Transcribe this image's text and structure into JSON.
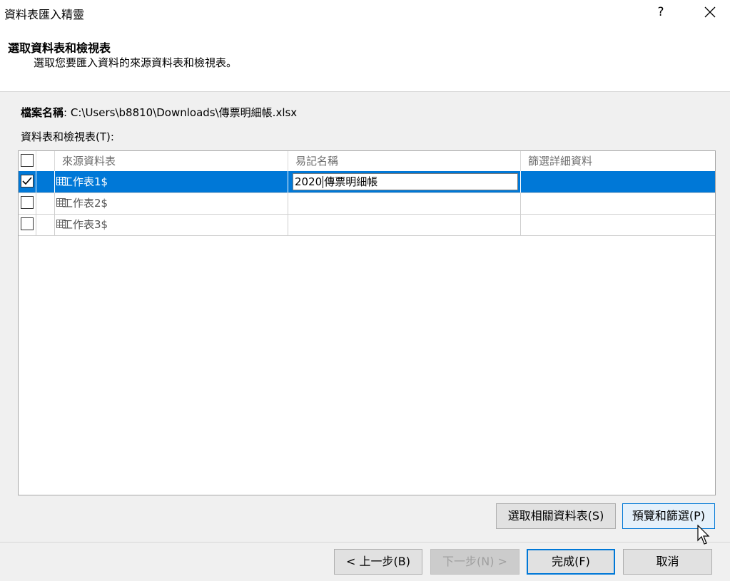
{
  "window": {
    "title": "資料表匯入精靈",
    "help": "?"
  },
  "header": {
    "title": "選取資料表和檢視表",
    "subtitle": "選取您要匯入資料的來源資料表和檢視表。"
  },
  "file": {
    "label": "檔案名稱",
    "separator": ":",
    "path": "C:\\Users\\b8810\\Downloads\\傳票明細帳.xlsx"
  },
  "tables_label": "資料表和檢視表(T):",
  "grid": {
    "columns": [
      "來源資料表",
      "易記名稱",
      "篩選詳細資料"
    ],
    "rows": [
      {
        "checked": true,
        "name": "工作表1$",
        "alias_a": "2020",
        "alias_b": "傳票明細帳",
        "filter": ""
      },
      {
        "checked": false,
        "name": "工作表2$",
        "alias": "",
        "filter": ""
      },
      {
        "checked": false,
        "name": "工作表3$",
        "alias": "",
        "filter": ""
      }
    ]
  },
  "buttons": {
    "select_related": "選取相關資料表(S)",
    "preview_filter": "預覽和篩選(P)",
    "back": "< 上一步(B)",
    "next": "下一步(N) >",
    "finish": "完成(F)",
    "cancel": "取消"
  },
  "colors": {
    "selection": "#0078d7",
    "dialog_bg": "#f0f0f0",
    "button_bg": "#e1e1e1"
  }
}
